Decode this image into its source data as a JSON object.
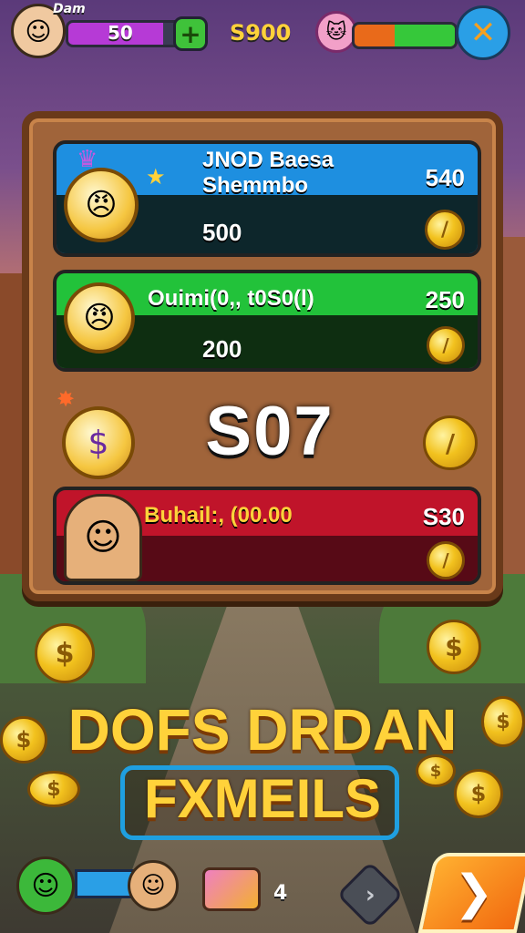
{
  "hud": {
    "player_label": "Dam",
    "player_score": "50",
    "coins": "S900",
    "left_bar_progress": 0.8,
    "right_bar_progress": 0.6,
    "add_icon": "plus-icon",
    "close_icon": "close-x-icon"
  },
  "board": {
    "rows": [
      {
        "title": "JNOD Baesa\nShemmbo",
        "value": "500",
        "score": "540",
        "color": "#1e8fe0"
      },
      {
        "title": "Ouimi(0,, t0S0(l)",
        "value": "200",
        "score": "250",
        "color": "#22c23a"
      },
      {
        "title": "Buhail:, (00.00",
        "value": "",
        "score": "S30",
        "color": "#c0142a"
      }
    ],
    "total": "S07"
  },
  "title": {
    "line1": "DOFS DRDAN",
    "line2": "FXMEILS"
  },
  "bottom": {
    "count": "4",
    "next_icon": "chevron-right-icon",
    "play_icon": "arrow-right-icon"
  },
  "colors": {
    "accent": "#ffd23a",
    "plate": "#1f9fe0",
    "hud_bar": "#b63ad6"
  }
}
